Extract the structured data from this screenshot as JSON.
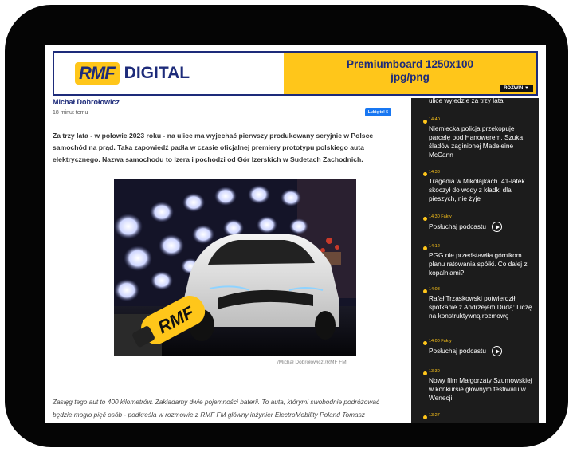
{
  "banner": {
    "logo_badge": "RMF",
    "logo_text": "DIGITAL",
    "ad_line1": "Premiumboard 1250x100",
    "ad_line2": "jpg/png",
    "expand_label": "ROZWIŃ ▼"
  },
  "article": {
    "author": "Michał Dobrołowicz",
    "time": "18 minut temu",
    "like_label": "Lubię to! 5",
    "lead": "Za trzy lata - w połowie 2023 roku - na ulice ma wyjechać pierwszy produkowany seryjnie w Polsce samochód na prąd. Taka zapowiedź padła w czasie oficjalnej premiery prototypu polskiego auta elektrycznego. Nazwa samochodu to Izera i pochodzi od Gór Izerskich w Sudetach Zachodnich.",
    "photo_mic_label": "RMF",
    "caption": "/Michał Dobrołowicz /RMF FM",
    "body_line1": "Zasięg tego aut to 400 kilometrów. Zakładamy dwie pojemności baterii. To auta, którymi swobodnie podróżować",
    "body_line2": "będzie mogło pięć osób - podkreśla w rozmowie z RMF FM główny inżynier ElectroMobility Poland Tomasz"
  },
  "sidebar": {
    "first_title": "ulice wyjedzie za trzy lata",
    "items": [
      {
        "time": "14:40",
        "title": "Niemiecka policja przekopuje parcelę pod Hanowerem. Szuka śladów zaginionej Madeleine McCann"
      },
      {
        "time": "14:38",
        "title": "Tragedia w Mikołajkach. 41-latek skoczył do wody z kładki dla pieszych, nie żyje"
      },
      {
        "time": "14:30 Fakty",
        "title": "Posłuchaj podcastu"
      },
      {
        "time": "14:12",
        "title": "PGG nie przedstawiła górnikom planu ratowania spółki. Co dalej z kopalniami?"
      },
      {
        "time": "14:08",
        "title": "Rafał Trzaskowski potwierdził spotkanie z Andrzejem Dudą: Liczę na konstruktywną rozmowę"
      },
      {
        "time": "14:00 Fakty",
        "title": "Posłuchaj podcastu"
      },
      {
        "time": "13:30",
        "title": "Nowy film Małgorzaty Szumowskiej w konkursie głównym festiwalu w Wenecji!"
      },
      {
        "time": "13:27",
        "title": ""
      }
    ]
  },
  "colors": {
    "brand_yellow": "#ffc61a",
    "brand_navy": "#1d2b7a",
    "sidebar_bg": "#1c1c1c"
  }
}
